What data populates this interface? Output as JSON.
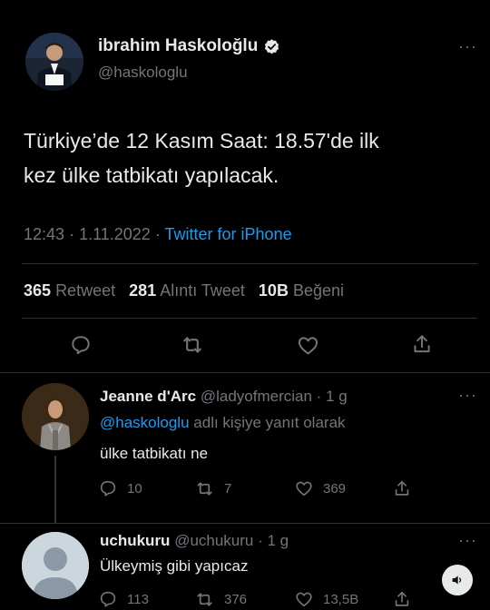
{
  "main_tweet": {
    "author_name": "ibrahim Haskoloğlu",
    "author_handle": "@haskologlu",
    "text_line1": "Türkiye’de 12 Kasım Saat: 18.57'de ilk",
    "text_line2": "kez ülke tatbikatı yapılacak.",
    "time": "12:43",
    "date": "1.11.2022",
    "dot": "·",
    "source": "Twitter for iPhone",
    "retweet_count": "365",
    "retweet_label": "Retweet",
    "quote_count": "281",
    "quote_label": "Alıntı Tweet",
    "like_count": "10B",
    "like_label": "Beğeni"
  },
  "replies": [
    {
      "name": "Jeanne d'Arc",
      "meta": "@ladyofmercian · 1 g",
      "reply_to_handle": "@haskologlu",
      "reply_to_suffix": "adlı kişiye yanıt olarak",
      "text": "ülke tatbikatı ne",
      "replies": "10",
      "retweets": "7",
      "likes": "369"
    },
    {
      "name": "uchukuru",
      "meta": "@uchukuru · 1 g",
      "text": "Ülkeymiş gibi yapıcaz",
      "replies": "113",
      "retweets": "376",
      "likes": "13,5B"
    }
  ],
  "colors": {
    "background": "#000000",
    "text": "#e7e9ea",
    "muted": "#71767b",
    "link": "#1d9bf0",
    "divider": "#2f3336"
  },
  "icons": [
    "verified-badge-icon",
    "more-icon",
    "reply-icon",
    "retweet-icon",
    "like-icon",
    "share-icon",
    "audio-icon"
  ]
}
